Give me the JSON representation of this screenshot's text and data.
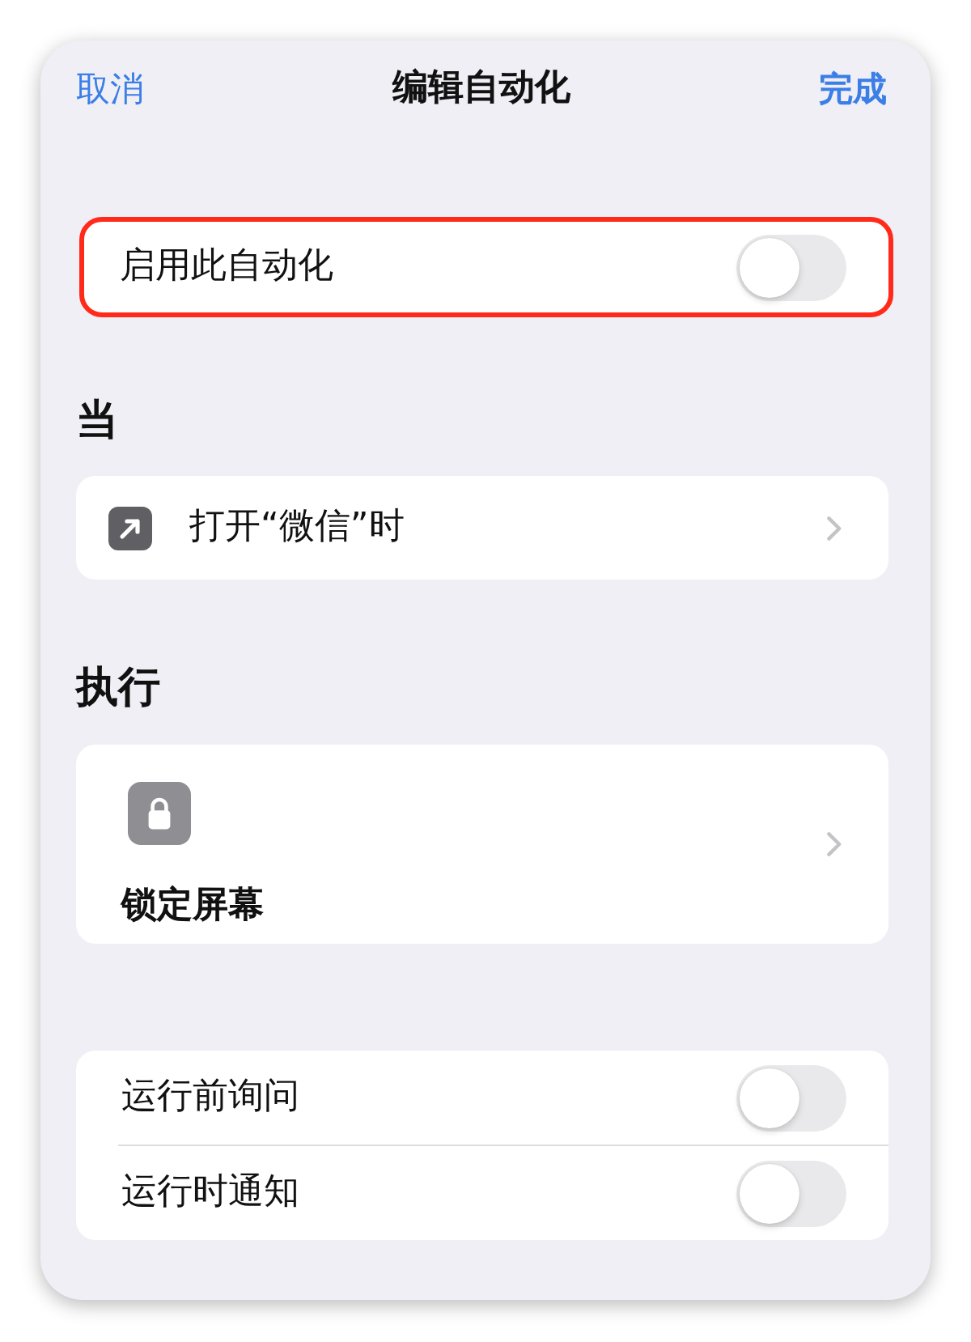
{
  "nav": {
    "cancel": "取消",
    "title": "编辑自动化",
    "done": "完成"
  },
  "enable": {
    "label": "启用此自动化",
    "on": false,
    "highlighted": true
  },
  "sections": [
    {
      "heading": "当",
      "items": [
        {
          "kind": "trigger",
          "label": "打开“微信”时"
        }
      ]
    },
    {
      "heading": "执行",
      "items": [
        {
          "kind": "action",
          "label": "锁定屏幕"
        }
      ]
    }
  ],
  "options": [
    {
      "label": "运行前询问",
      "on": false
    },
    {
      "label": "运行时通知",
      "on": false
    }
  ]
}
